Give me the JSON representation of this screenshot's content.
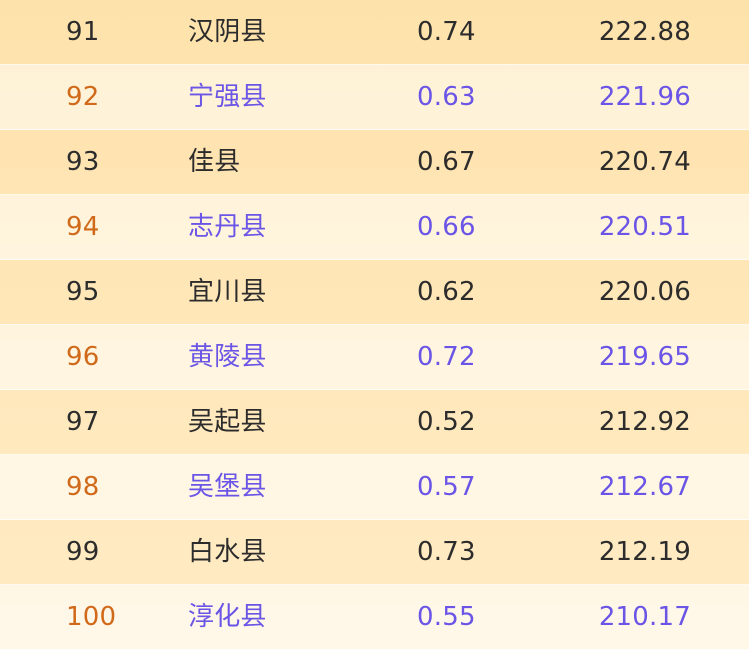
{
  "rows": [
    {
      "rank": "91",
      "county": "汉阴县",
      "ratio": "0.74",
      "value": "222.88"
    },
    {
      "rank": "92",
      "county": "宁强县",
      "ratio": "0.63",
      "value": "221.96"
    },
    {
      "rank": "93",
      "county": "佳县",
      "ratio": "0.67",
      "value": "220.74"
    },
    {
      "rank": "94",
      "county": "志丹县",
      "ratio": "0.66",
      "value": "220.51"
    },
    {
      "rank": "95",
      "county": "宜川县",
      "ratio": "0.62",
      "value": "220.06"
    },
    {
      "rank": "96",
      "county": "黄陵县",
      "ratio": "0.72",
      "value": "219.65"
    },
    {
      "rank": "97",
      "county": "吴起县",
      "ratio": "0.52",
      "value": "212.92"
    },
    {
      "rank": "98",
      "county": "吴堡县",
      "ratio": "0.57",
      "value": "212.67"
    },
    {
      "rank": "99",
      "county": "白水县",
      "ratio": "0.73",
      "value": "212.19"
    },
    {
      "rank": "100",
      "county": "淳化县",
      "ratio": "0.55",
      "value": "210.17"
    }
  ],
  "colors": {
    "odd_text": "#2c2c2c",
    "even_rank": "#d06a1a",
    "even_text": "#6a55e6",
    "row_odd_bg": "#fde0a6",
    "row_even_bg": "#fff5e3"
  }
}
